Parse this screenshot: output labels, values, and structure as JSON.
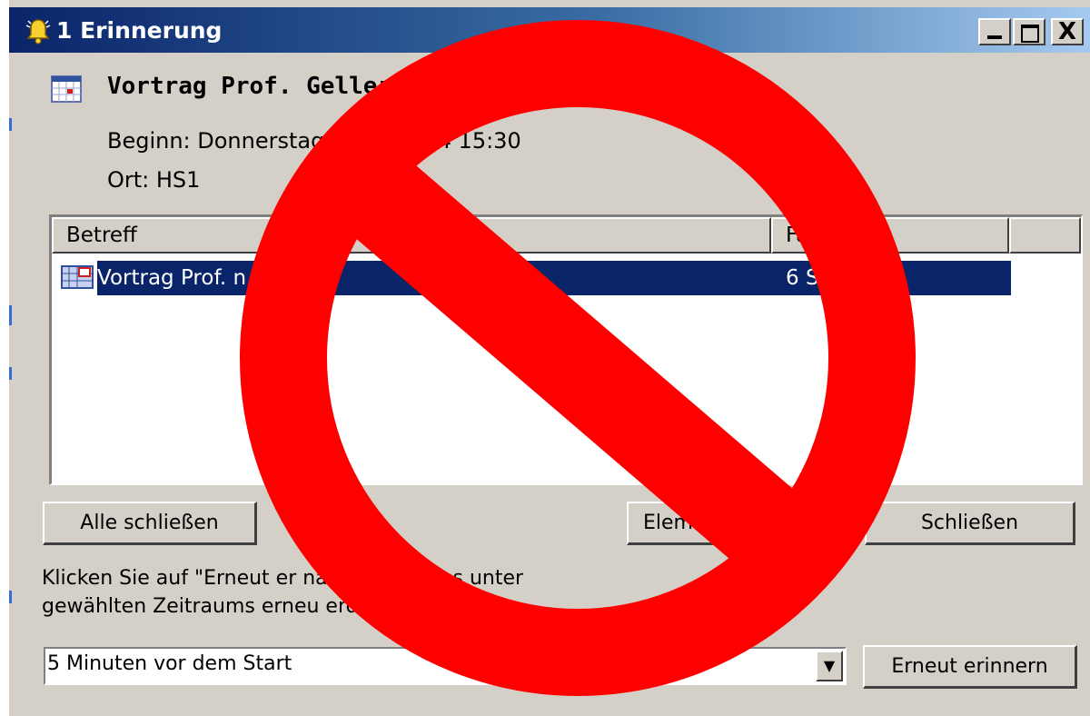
{
  "window": {
    "title": "1 Erinnerung",
    "caption_buttons": {
      "minimize": "_",
      "maximize": "□",
      "close": "X"
    }
  },
  "reminder": {
    "subject": "Vortrag Prof. Gellerse",
    "start": "Beginn: Donnerstag                  mber 2004 15:30",
    "location": "Ort: HS1"
  },
  "list": {
    "columns": [
      "Betreff",
      "Fä",
      ""
    ],
    "rows": [
      {
        "subject": "Vortrag Prof.         n",
        "due": "6 St",
        "selected": true
      }
    ]
  },
  "buttons": {
    "dismiss_all": "Alle schließen",
    "open_item": "Elem",
    "dismiss": "Schließen",
    "snooze": "Erneut erinnern"
  },
  "hint": {
    "line1": "Klicken Sie auf \"Erneut er                 nach Ablauf des unter",
    "line2": "gewählten Zeitraums erneu                    erden."
  },
  "snooze_select": {
    "value": "5 Minuten vor dem Start"
  },
  "overlay": {
    "symbol": "prohibition-sign",
    "color": "#ff0000"
  }
}
